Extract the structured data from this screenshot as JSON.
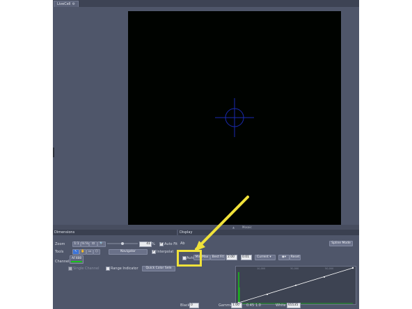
{
  "tab": {
    "label": "LiveCell",
    "close_glyph": "⚙"
  },
  "viewport": {
    "background": "#000300",
    "crosshair_color": "#1a2ab0"
  },
  "status": {
    "label": "Mosaic",
    "arrow": "▲"
  },
  "panels": {
    "dimensions_title": "Dimensions",
    "display_title": "Display"
  },
  "dimensions": {
    "zoom_label": "Zoom",
    "zoom_buttons": [
      "1:1",
      "½:½",
      "⊡",
      "🔍"
    ],
    "zoom_value": "41",
    "zoom_unit": "%",
    "auto_fit_label": "Auto Fit",
    "tools_label": "Tools",
    "tool_buttons": [
      "↖",
      "✋",
      "▭",
      "⬡"
    ],
    "navigator_label": "Navigator",
    "interpolation_label": "Interpolat",
    "channels_label": "Channels",
    "channel_name": "AF488",
    "channel_color": "#19c219",
    "single_channel_label": "Single Channel",
    "range_indicator_label": "Range Indicator",
    "quick_color_label": "Quick Color Sele"
  },
  "display": {
    "channel_prefix": "Ab",
    "spline_mode_label": "Spline Mode",
    "auto_label": "Auto",
    "min_max_label": "Min/Max",
    "best_fit_label": "Best Fit",
    "best_fit_value": "2.00",
    "best_fit_percent": "0.01",
    "current_label": "Current",
    "reset_label": "Reset",
    "histo_ticks": [
      "10,000",
      "30,000",
      "50,000"
    ],
    "black_label": "Black",
    "black_value": "0",
    "gamma_label": "Gamma",
    "gamma_value": "1.00",
    "gamma_low": "0.45",
    "gamma_high": "1.0",
    "white_label": "White",
    "white_value": "65535"
  },
  "annotation": {
    "color": "#f0e23a"
  }
}
